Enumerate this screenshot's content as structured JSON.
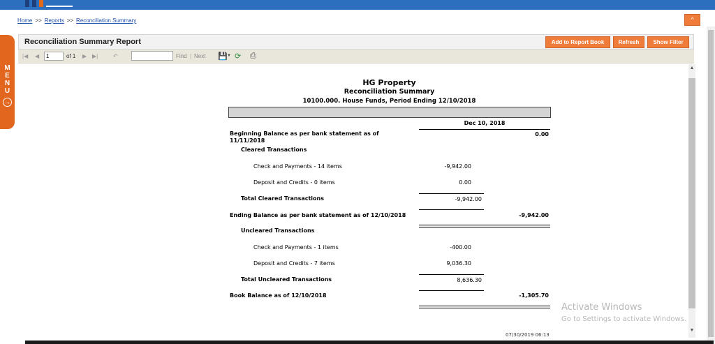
{
  "breadcrumb": {
    "home": "Home",
    "reports": "Reports",
    "current": "Reconciliation Summary",
    "sep": ">>"
  },
  "header": {
    "title": "Reconciliation Summary Report",
    "add_button": "Add to Report Book",
    "refresh_button": "Refresh",
    "filter_button": "Show Filter",
    "collapse_icon": "^"
  },
  "side_menu": {
    "letters": "M\nE\nN\nU",
    "icon": "arrow-right-circle-icon"
  },
  "toolbar": {
    "page_value": "1",
    "of_label": "of 1",
    "find_label": "Find",
    "next_label": "Next",
    "divider": "|"
  },
  "report": {
    "company": "HG Property",
    "title": "Reconciliation Summary",
    "subtitle": "10100.000. House Funds, Period Ending 12/10/2018",
    "date_col": "Dec 10, 2018",
    "begin_label": "Beginning Balance as per bank statement as of",
    "begin_label2": "11/11/2018",
    "begin_value": "0.00",
    "cleared_header": "Cleared Transactions",
    "cleared_check_label": "Check and Payments -  14 items",
    "cleared_check_value": "-9,942.00",
    "cleared_deposit_label": "Deposit and Credits -  0 items",
    "cleared_deposit_value": "0.00",
    "total_cleared_label": "Total Cleared Transactions",
    "total_cleared_value": "-9,942.00",
    "ending_label": "Ending Balance as per bank statement as of 12/10/2018",
    "ending_value": "-9,942.00",
    "uncleared_header": "Uncleared Transactions",
    "uncleared_check_label": "Check and Payments -  1 items",
    "uncleared_check_value": "-400.00",
    "uncleared_deposit_label": "Deposit and Credits -  7 items",
    "uncleared_deposit_value": "9,036.30",
    "total_uncleared_label": "Total Uncleared Transactions",
    "total_uncleared_value": "8,636.30",
    "book_label": "Book Balance as of 12/10/2018",
    "book_value": "-1,305.70",
    "footer_timestamp": "07/30/2019 06:13"
  },
  "watermark": {
    "line1": "Activate Windows",
    "line2": "Go to Settings to activate Windows."
  },
  "colors": {
    "brand_blue": "#2d6fbf",
    "accent_orange": "#f07c3c"
  }
}
